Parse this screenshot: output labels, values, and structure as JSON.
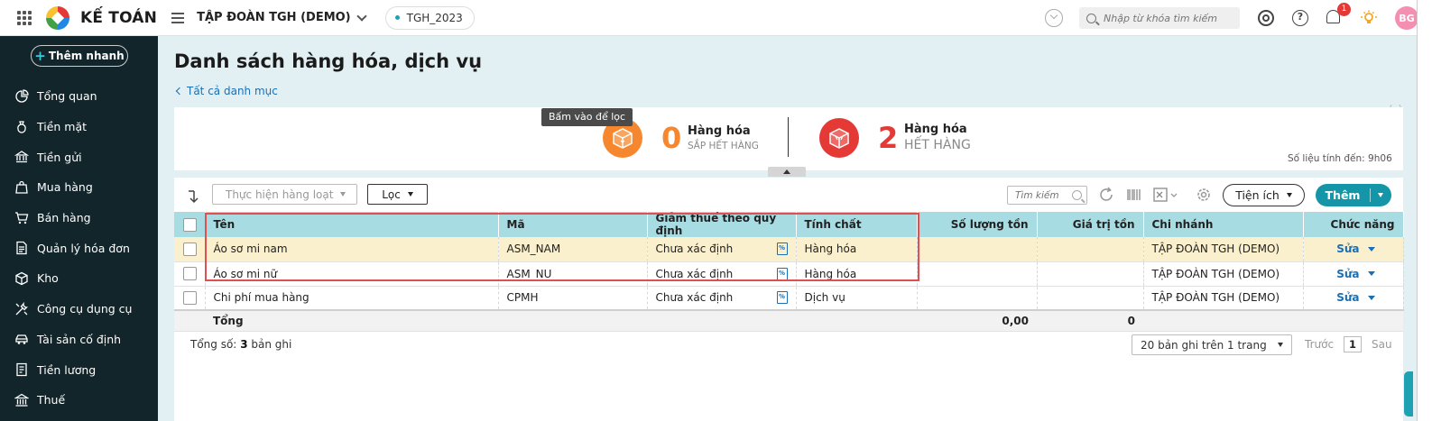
{
  "topbar": {
    "app_name": "KẾ TOÁN",
    "company": "TẬP ĐOÀN TGH (DEMO)",
    "year": "TGH_2023",
    "search_placeholder": "Nhập từ khóa tìm kiếm",
    "notification_count": "1",
    "avatar_initials": "BG"
  },
  "sidebar": {
    "quick_add_label": "Thêm nhanh",
    "items": [
      {
        "label": "Tổng quan",
        "icon": "chart-pie-icon"
      },
      {
        "label": "Tiền mặt",
        "icon": "money-bag-icon"
      },
      {
        "label": "Tiền gửi",
        "icon": "bank-icon"
      },
      {
        "label": "Mua hàng",
        "icon": "shopping-bag-icon"
      },
      {
        "label": "Bán hàng",
        "icon": "cart-icon"
      },
      {
        "label": "Quản lý hóa đơn",
        "icon": "invoice-icon"
      },
      {
        "label": "Kho",
        "icon": "warehouse-icon"
      },
      {
        "label": "Công cụ dụng cụ",
        "icon": "tools-icon"
      },
      {
        "label": "Tài sản cố định",
        "icon": "car-icon"
      },
      {
        "label": "Tiền lương",
        "icon": "payroll-icon"
      },
      {
        "label": "Thuế",
        "icon": "tax-building-icon"
      }
    ]
  },
  "page": {
    "title": "Danh sách hàng hóa, dịch vụ",
    "back_link": "Tất cả danh mục"
  },
  "summary": {
    "tooltip": "Bấm vào để lọc",
    "near_out": {
      "count": "0",
      "label": "Hàng hóa",
      "sub": "SẮP HẾT HÀNG"
    },
    "out": {
      "count": "2",
      "label": "Hàng hóa",
      "sub": "HẾT HÀNG"
    },
    "as_of": "Số liệu tính đến: 9h06"
  },
  "toolbar": {
    "bulk_action": "Thực hiện hàng loạt",
    "filter": "Lọc",
    "search_placeholder": "Tìm kiếm",
    "utilities": "Tiện ích",
    "add": "Thêm"
  },
  "table": {
    "columns": {
      "name": "Tên",
      "code": "Mã",
      "tax": "Giảm thuế theo quy định",
      "nature": "Tính chất",
      "qty": "Số lượng tồn",
      "value": "Giá trị tồn",
      "branch": "Chi nhánh",
      "action": "Chức năng"
    },
    "rows": [
      {
        "name": "Áo sơ mi nam",
        "code": "ASM_NAM",
        "tax": "Chưa xác định",
        "nature": "Hàng hóa",
        "qty": "",
        "value": "",
        "branch": "TẬP ĐOÀN TGH (DEMO)",
        "action": "Sửa"
      },
      {
        "name": "Áo sơ mi nữ",
        "code": "ASM_NU",
        "tax": "Chưa xác định",
        "nature": "Hàng hóa",
        "qty": "",
        "value": "",
        "branch": "TẬP ĐOÀN TGH (DEMO)",
        "action": "Sửa"
      },
      {
        "name": "Chi phí mua hàng",
        "code": "CPMH",
        "tax": "Chưa xác định",
        "nature": "Dịch vụ",
        "qty": "",
        "value": "",
        "branch": "TẬP ĐOÀN TGH (DEMO)",
        "action": "Sửa"
      }
    ],
    "total": {
      "label": "Tổng",
      "qty": "0,00",
      "value": "0"
    }
  },
  "footer": {
    "total_prefix": "Tổng số:",
    "total_count": "3",
    "total_suffix": "bản ghi",
    "page_size": "20 bản ghi trên 1 trang",
    "prev": "Trước",
    "page": "1",
    "next": "Sau"
  }
}
